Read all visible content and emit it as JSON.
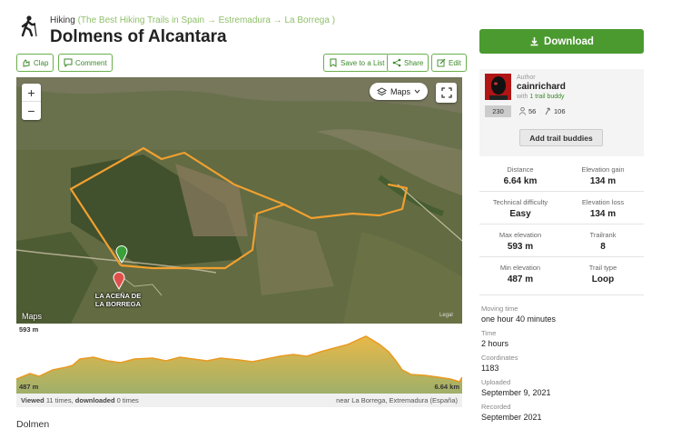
{
  "header": {
    "activity": "Hiking",
    "breadcrumb_trail": "(The Best Hiking Trails in Spain → Estremadura → La Borrega )",
    "title": "Dolmens of Alcantara",
    "icon": "hiker-icon"
  },
  "actions": {
    "clap": "Clap",
    "comment": "Comment",
    "save": "Save to a List",
    "share": "Share",
    "edit": "Edit"
  },
  "download": {
    "label": "Download"
  },
  "map": {
    "maps_button": "Maps",
    "zoom_in": "+",
    "zoom_out": "−",
    "place_label": "LA ACEÑA DE LA BORREGA",
    "maps_logo": "Maps",
    "legal": "Legal",
    "track_color": "#f0a030"
  },
  "profile": {
    "max_elevation": "593 m",
    "min_elevation": "487 m",
    "distance": "6.64 km",
    "fill_color": "#9fb06a"
  },
  "views": {
    "viewed_label": "Viewed",
    "viewed_count": "11 times,",
    "downloaded_label": "downloaded",
    "downloaded_count": "0 times",
    "location": "near La Borrega, Extremadura (España)"
  },
  "description": "Dolmen",
  "author": {
    "label": "Author",
    "name": "cainrichard",
    "buddies_prefix": "with",
    "buddies": "1 trail buddy",
    "count": "230",
    "stat_one": "56",
    "stat_two": "106",
    "add_buddies": "Add trail buddies"
  },
  "stats": {
    "distance": {
      "label": "Distance",
      "value": "6.64 km"
    },
    "elevation_gain": {
      "label": "Elevation gain",
      "value": "134 m"
    },
    "technical_difficulty": {
      "label": "Technical difficulty",
      "value": "Easy"
    },
    "elevation_loss": {
      "label": "Elevation loss",
      "value": "134 m"
    },
    "max_elevation": {
      "label": "Max elevation",
      "value": "593 m"
    },
    "trailrank": {
      "label": "Trailrank",
      "value": "8"
    },
    "min_elevation": {
      "label": "Min elevation",
      "value": "487 m"
    },
    "trail_type": {
      "label": "Trail type",
      "value": "Loop"
    }
  },
  "details": {
    "moving_time": {
      "label": "Moving time",
      "value": "one hour 40 minutes"
    },
    "time": {
      "label": "Time",
      "value": "2 hours"
    },
    "coordinates": {
      "label": "Coordinates",
      "value": "1183"
    },
    "uploaded": {
      "label": "Uploaded",
      "value": "September 9, 2021"
    },
    "recorded": {
      "label": "Recorded",
      "value": "September 2021"
    }
  },
  "colors": {
    "brand_green": "#4a9a30",
    "link_green": "#3c8a2a"
  }
}
